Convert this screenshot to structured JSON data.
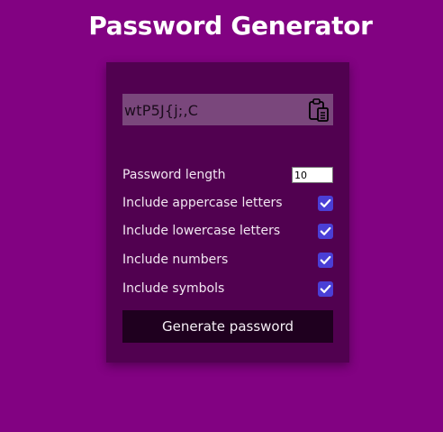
{
  "page": {
    "title": "Password Generator"
  },
  "result": {
    "password": "wtP5J{j;,C"
  },
  "settings": {
    "length_label": "Password length",
    "length_value": "10",
    "uppercase_label": "Include appercase letters",
    "lowercase_label": "Include lowercase letters",
    "numbers_label": "Include numbers",
    "symbols_label": "Include symbols",
    "uppercase_checked": true,
    "lowercase_checked": true,
    "numbers_checked": true,
    "symbols_checked": true
  },
  "actions": {
    "generate_label": "Generate password"
  },
  "icons": {
    "clipboard": "clipboard-icon",
    "checkmark": "checkmark-icon"
  },
  "colors": {
    "background": "#820282",
    "card": "#510150",
    "result_box": "#7a477c",
    "checkbox": "#4a3fd6",
    "button": "#1f001f"
  }
}
